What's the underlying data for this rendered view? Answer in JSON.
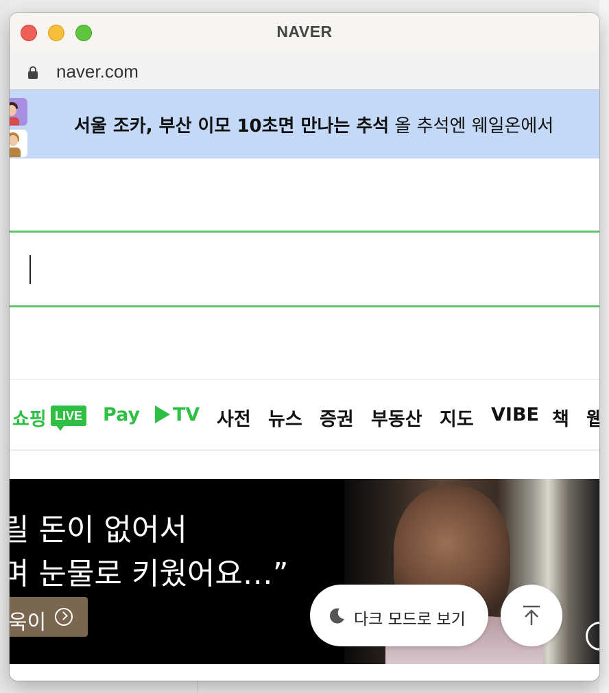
{
  "window": {
    "title": "NAVER",
    "url": "naver.com"
  },
  "banner": {
    "headline_bold": "서울 조카, 부산 이모 10초면 만나는 추석",
    "headline_rest": " 올 추석엔 웨일온에서"
  },
  "search": {
    "value": ""
  },
  "services": [
    {
      "label": "쇼핑",
      "badge": "LIVE"
    },
    {
      "label": "Pay"
    },
    {
      "label": "TV"
    },
    {
      "label": "사전"
    },
    {
      "label": "뉴스"
    },
    {
      "label": "증권"
    },
    {
      "label": "부동산"
    },
    {
      "label": "지도"
    },
    {
      "label": "VIBE"
    },
    {
      "label": "책"
    },
    {
      "label": "웹"
    }
  ],
  "ad": {
    "line1": "릴 돈이 없어서",
    "line2": "며 눈물로 키웠어요…”",
    "cta": "욱이"
  },
  "floating": {
    "dark_mode_label": "다크 모드로 보기"
  },
  "colors": {
    "naver_green": "#2fbf45",
    "search_border": "#5ec46a",
    "banner_bg": "#c3d9f7",
    "ad_cta_bg": "#7b6650"
  },
  "icons": [
    "lock-icon",
    "moon-icon",
    "arrow-up-to-top-icon",
    "chevron-right-circle-icon",
    "play-icon"
  ]
}
